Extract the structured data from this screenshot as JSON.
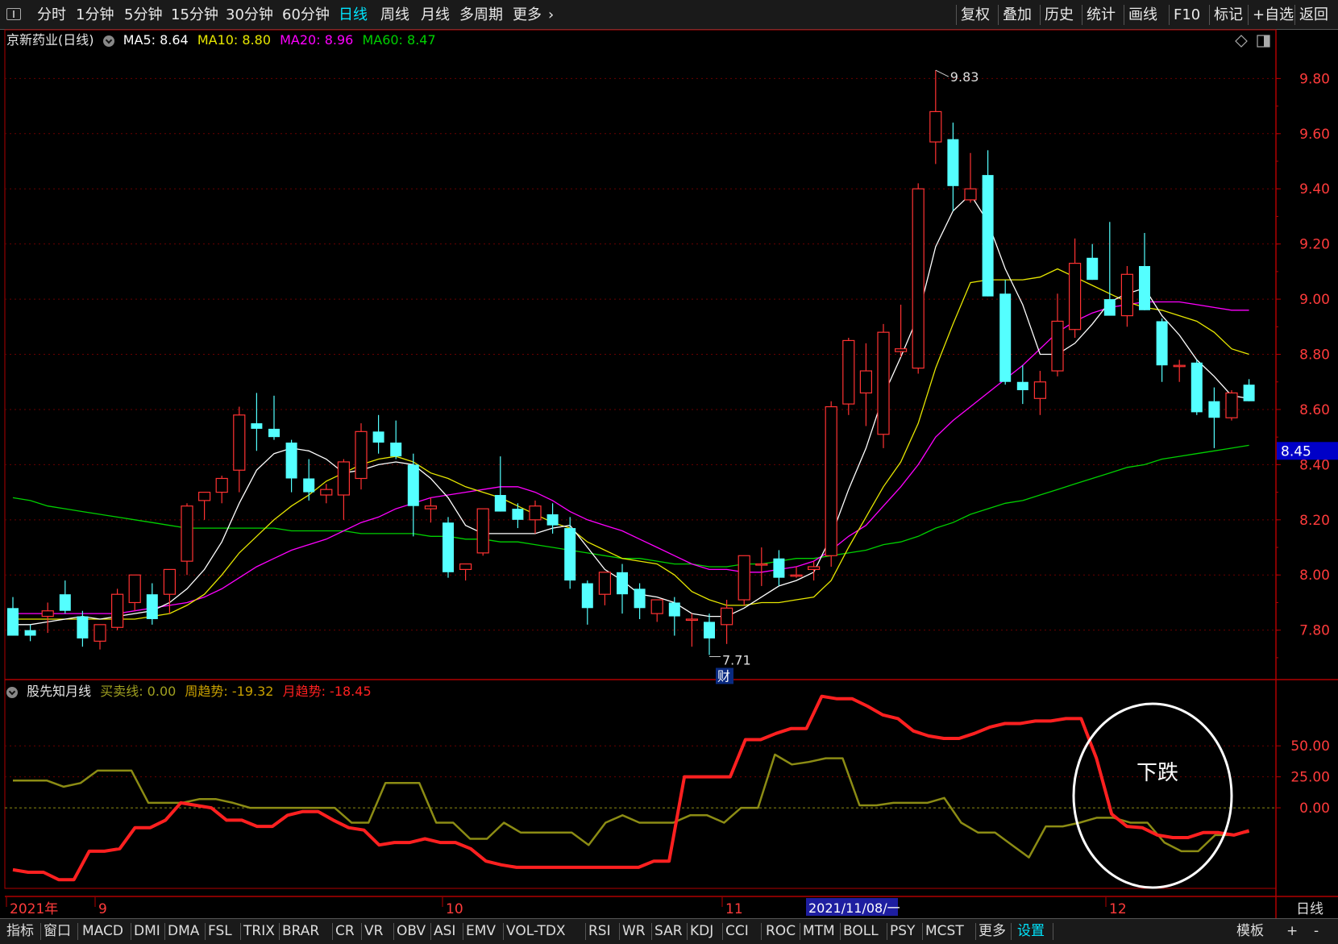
{
  "toolbar": {
    "left": [
      "分时",
      "1分钟",
      "5分钟",
      "15分钟",
      "30分钟",
      "60分钟",
      "日线",
      "周线",
      "月线",
      "多周期",
      "更多"
    ],
    "active": "日线",
    "right": [
      "复权",
      "叠加",
      "历史",
      "统计",
      "画线",
      "F10",
      "标记",
      "+自选",
      "返回"
    ]
  },
  "main_info": {
    "name": "京新药业(日线)",
    "ma5": "MA5: 8.64",
    "ma10": "MA10: 8.80",
    "ma20": "MA20: 8.96",
    "ma60": "MA60: 8.47"
  },
  "indicator_info": {
    "name": "股先知月线",
    "buysell": "买卖线: 0.00",
    "weekly": "周趋势: -19.32",
    "monthly": "月趋势: -18.45"
  },
  "price_axis": [
    "9.80",
    "9.60",
    "9.40",
    "9.20",
    "9.00",
    "8.80",
    "8.60",
    "8.40",
    "8.20",
    "8.00",
    "7.80"
  ],
  "current_price": "8.45",
  "high_label": "9.83",
  "low_label": "7.71",
  "fin_marker": "财",
  "indicator_axis": [
    "50.00",
    "25.00",
    "0.00"
  ],
  "annotation": "下跌",
  "date_axis": {
    "labels": [
      "2021年",
      "9",
      "10",
      "11",
      "12"
    ],
    "selected": "2021/11/08/一",
    "period": "日线"
  },
  "bottom_tabs": [
    "指标",
    "窗口",
    "MACD",
    "DMI",
    "DMA",
    "FSL",
    "TRIX",
    "BRAR",
    "CR",
    "VR",
    "OBV",
    "ASI",
    "EMV",
    "VOL-TDX",
    "RSI",
    "WR",
    "SAR",
    "KDJ",
    "CCI",
    "ROC",
    "MTM",
    "BOLL",
    "PSY",
    "MCST",
    "更多",
    "设置"
  ],
  "bottom_right": [
    "模板",
    "+",
    "-"
  ],
  "colors": {
    "up": "#ff3232",
    "down": "#54ffff",
    "ma5": "#ffffff",
    "ma10": "#e6e600",
    "ma20": "#ff00ff",
    "ma60": "#00d000",
    "weekly": "#8c8c14",
    "monthly": "#ff2020"
  },
  "chart_data": {
    "type": "candlestick",
    "ylim": [
      7.65,
      9.88
    ],
    "candles": [
      [
        7.88,
        7.92,
        7.78,
        7.78
      ],
      [
        7.8,
        7.82,
        7.76,
        7.78
      ],
      [
        7.85,
        7.9,
        7.79,
        7.87
      ],
      [
        7.93,
        7.98,
        7.86,
        7.87
      ],
      [
        7.85,
        7.87,
        7.74,
        7.77
      ],
      [
        7.76,
        7.82,
        7.73,
        7.82
      ],
      [
        7.81,
        7.95,
        7.8,
        7.93
      ],
      [
        7.9,
        8.0,
        7.87,
        8.0
      ],
      [
        7.93,
        7.97,
        7.82,
        7.84
      ],
      [
        7.93,
        8.02,
        7.86,
        8.02
      ],
      [
        8.05,
        8.26,
        8.0,
        8.25
      ],
      [
        8.27,
        8.3,
        8.2,
        8.3
      ],
      [
        8.3,
        8.36,
        8.26,
        8.35
      ],
      [
        8.38,
        8.61,
        8.3,
        8.58
      ],
      [
        8.55,
        8.66,
        8.45,
        8.53
      ],
      [
        8.53,
        8.65,
        8.49,
        8.5
      ],
      [
        8.48,
        8.49,
        8.3,
        8.35
      ],
      [
        8.35,
        8.42,
        8.27,
        8.3
      ],
      [
        8.29,
        8.33,
        8.26,
        8.31
      ],
      [
        8.29,
        8.42,
        8.2,
        8.41
      ],
      [
        8.35,
        8.55,
        8.31,
        8.52
      ],
      [
        8.52,
        8.58,
        8.44,
        8.48
      ],
      [
        8.48,
        8.56,
        8.42,
        8.43
      ],
      [
        8.4,
        8.44,
        8.14,
        8.25
      ],
      [
        8.24,
        8.28,
        8.19,
        8.25
      ],
      [
        8.19,
        8.21,
        7.99,
        8.01
      ],
      [
        8.02,
        8.04,
        7.98,
        8.04
      ],
      [
        8.08,
        8.24,
        8.07,
        8.24
      ],
      [
        8.29,
        8.43,
        8.23,
        8.23
      ],
      [
        8.24,
        8.26,
        8.17,
        8.2
      ],
      [
        8.2,
        8.27,
        8.15,
        8.25
      ],
      [
        8.22,
        8.26,
        8.15,
        8.18
      ],
      [
        8.17,
        8.21,
        7.95,
        7.98
      ],
      [
        7.97,
        7.98,
        7.82,
        7.88
      ],
      [
        7.93,
        8.01,
        7.89,
        8.01
      ],
      [
        8.01,
        8.04,
        7.86,
        7.93
      ],
      [
        7.95,
        7.97,
        7.84,
        7.88
      ],
      [
        7.86,
        7.91,
        7.83,
        7.91
      ],
      [
        7.9,
        7.92,
        7.78,
        7.85
      ],
      [
        7.84,
        7.86,
        7.74,
        7.84
      ],
      [
        7.83,
        7.86,
        7.71,
        7.77
      ],
      [
        7.82,
        7.91,
        7.75,
        7.88
      ],
      [
        7.91,
        8.07,
        7.89,
        8.07
      ],
      [
        8.04,
        8.1,
        7.96,
        8.04
      ],
      [
        8.06,
        8.09,
        7.96,
        7.99
      ],
      [
        8.0,
        8.03,
        7.99,
        8.0
      ],
      [
        8.02,
        8.05,
        7.98,
        8.03
      ],
      [
        8.07,
        8.63,
        8.03,
        8.61
      ],
      [
        8.62,
        8.86,
        8.58,
        8.85
      ],
      [
        8.66,
        8.84,
        8.54,
        8.74
      ],
      [
        8.51,
        8.91,
        8.46,
        8.88
      ],
      [
        8.81,
        8.98,
        8.79,
        8.82
      ],
      [
        8.75,
        9.42,
        8.73,
        9.4
      ],
      [
        9.57,
        9.83,
        9.49,
        9.68
      ],
      [
        9.58,
        9.64,
        9.32,
        9.41
      ],
      [
        9.36,
        9.53,
        9.35,
        9.4
      ],
      [
        9.45,
        9.54,
        9.01,
        9.01
      ],
      [
        9.02,
        9.07,
        8.69,
        8.7
      ],
      [
        8.7,
        8.76,
        8.62,
        8.67
      ],
      [
        8.64,
        8.74,
        8.58,
        8.7
      ],
      [
        8.74,
        9.02,
        8.72,
        8.92
      ],
      [
        8.89,
        9.22,
        8.86,
        9.13
      ],
      [
        9.15,
        9.2,
        9.07,
        9.07
      ],
      [
        9.0,
        9.28,
        8.98,
        8.94
      ],
      [
        8.94,
        9.12,
        8.9,
        9.09
      ],
      [
        9.12,
        9.24,
        8.96,
        8.96
      ],
      [
        8.92,
        8.93,
        8.7,
        8.76
      ],
      [
        8.76,
        8.78,
        8.7,
        8.76
      ],
      [
        8.77,
        8.78,
        8.58,
        8.59
      ],
      [
        8.63,
        8.68,
        8.46,
        8.57
      ],
      [
        8.57,
        8.67,
        8.56,
        8.66
      ],
      [
        8.69,
        8.71,
        8.63,
        8.63
      ]
    ],
    "ma5": [
      7.82,
      7.82,
      7.83,
      7.84,
      7.85,
      7.84,
      7.85,
      7.86,
      7.87,
      7.9,
      7.95,
      8.02,
      8.12,
      8.26,
      8.38,
      8.44,
      8.46,
      8.45,
      8.42,
      8.37,
      8.38,
      8.4,
      8.41,
      8.4,
      8.35,
      8.28,
      8.18,
      8.15,
      8.15,
      8.15,
      8.15,
      8.17,
      8.18,
      8.1,
      8.02,
      7.98,
      7.93,
      7.92,
      7.9,
      7.86,
      7.85,
      7.85,
      7.88,
      7.92,
      7.96,
      7.98,
      8.01,
      8.14,
      8.31,
      8.46,
      8.65,
      8.79,
      8.94,
      9.19,
      9.32,
      9.38,
      9.28,
      9.11,
      8.98,
      8.8,
      8.8,
      8.84,
      8.91,
      8.99,
      9.02,
      9.04,
      8.94,
      8.87,
      8.78,
      8.72,
      8.65,
      8.64
    ],
    "ma10": [
      7.84,
      7.84,
      7.84,
      7.84,
      7.84,
      7.84,
      7.84,
      7.84,
      7.85,
      7.86,
      7.89,
      7.93,
      8.0,
      8.08,
      8.14,
      8.2,
      8.25,
      8.29,
      8.34,
      8.37,
      8.4,
      8.42,
      8.43,
      8.41,
      8.37,
      8.35,
      8.32,
      8.3,
      8.28,
      8.25,
      8.22,
      8.19,
      8.17,
      8.12,
      8.09,
      8.06,
      8.05,
      8.04,
      8.0,
      7.94,
      7.91,
      7.89,
      7.89,
      7.9,
      7.9,
      7.91,
      7.92,
      7.98,
      8.1,
      8.21,
      8.32,
      8.41,
      8.55,
      8.75,
      8.91,
      9.06,
      9.07,
      9.07,
      9.07,
      9.08,
      9.11,
      9.08,
      9.05,
      9.02,
      8.99,
      8.97,
      8.96,
      8.94,
      8.92,
      8.88,
      8.82,
      8.8
    ],
    "ma20": [
      7.86,
      7.86,
      7.86,
      7.86,
      7.86,
      7.86,
      7.86,
      7.87,
      7.88,
      7.89,
      7.9,
      7.92,
      7.95,
      7.99,
      8.03,
      8.06,
      8.09,
      8.11,
      8.13,
      8.16,
      8.19,
      8.21,
      8.24,
      8.26,
      8.28,
      8.29,
      8.3,
      8.31,
      8.32,
      8.32,
      8.3,
      8.27,
      8.23,
      8.2,
      8.18,
      8.16,
      8.13,
      8.1,
      8.07,
      8.04,
      8.02,
      8.02,
      8.01,
      8.01,
      8.02,
      8.03,
      8.05,
      8.09,
      8.14,
      8.18,
      8.25,
      8.32,
      8.4,
      8.5,
      8.56,
      8.61,
      8.66,
      8.71,
      8.76,
      8.82,
      8.88,
      8.92,
      8.95,
      8.97,
      8.98,
      8.99,
      8.99,
      8.99,
      8.98,
      8.97,
      8.96,
      8.96
    ],
    "ma60": [
      8.28,
      8.27,
      8.25,
      8.24,
      8.23,
      8.22,
      8.21,
      8.2,
      8.19,
      8.18,
      8.17,
      8.17,
      8.17,
      8.17,
      8.17,
      8.17,
      8.16,
      8.16,
      8.16,
      8.16,
      8.15,
      8.15,
      8.15,
      8.15,
      8.14,
      8.14,
      8.13,
      8.13,
      8.12,
      8.12,
      8.11,
      8.1,
      8.09,
      8.08,
      8.07,
      8.06,
      8.06,
      8.05,
      8.04,
      8.04,
      8.03,
      8.03,
      8.04,
      8.04,
      8.05,
      8.06,
      8.06,
      8.07,
      8.08,
      8.09,
      8.11,
      8.12,
      8.14,
      8.17,
      8.19,
      8.22,
      8.24,
      8.26,
      8.27,
      8.29,
      8.31,
      8.33,
      8.35,
      8.37,
      8.39,
      8.4,
      8.42,
      8.43,
      8.44,
      8.45,
      8.46,
      8.47
    ],
    "indicator": {
      "ylim": [
        -65,
        95
      ],
      "buysell": 0,
      "weekly": [
        22,
        22,
        22,
        17,
        20,
        30,
        30,
        30,
        4,
        4,
        4,
        7,
        7,
        4,
        0,
        0,
        0,
        0,
        0,
        0,
        -12,
        -12,
        20,
        20,
        20,
        -12,
        -12,
        -25,
        -25,
        -12,
        -20,
        -20,
        -20,
        -20,
        -30,
        -12,
        -6,
        -12,
        -12,
        -12,
        -6,
        -6,
        -12,
        0,
        0,
        43,
        35,
        37,
        40,
        40,
        2,
        2,
        4,
        4,
        4,
        8,
        -12,
        -20,
        -20,
        -30,
        -40,
        -15,
        -15,
        -12,
        -8,
        -8,
        -12,
        -12,
        -28,
        -35,
        -35,
        -22,
        -22,
        -19.32
      ],
      "monthly": [
        -50,
        -52,
        -52,
        -58,
        -58,
        -35,
        -35,
        -33,
        -16,
        -16,
        -10,
        4,
        2,
        0,
        -10,
        -10,
        -15,
        -15,
        -6,
        -3,
        -3,
        -10,
        -16,
        -18,
        -30,
        -28,
        -28,
        -25,
        -28,
        -28,
        -33,
        -43,
        -46,
        -48,
        -48,
        -48,
        -48,
        -48,
        -48,
        -48,
        -48,
        -48,
        -43,
        -43,
        25,
        25,
        25,
        25,
        55,
        55,
        60,
        64,
        64,
        90,
        88,
        88,
        82,
        75,
        72,
        62,
        58,
        56,
        56,
        60,
        65,
        68,
        68,
        70,
        70,
        72,
        72,
        40,
        -5,
        -15,
        -16,
        -22,
        -24,
        -24,
        -20,
        -20,
        -22,
        -18.45
      ]
    }
  }
}
